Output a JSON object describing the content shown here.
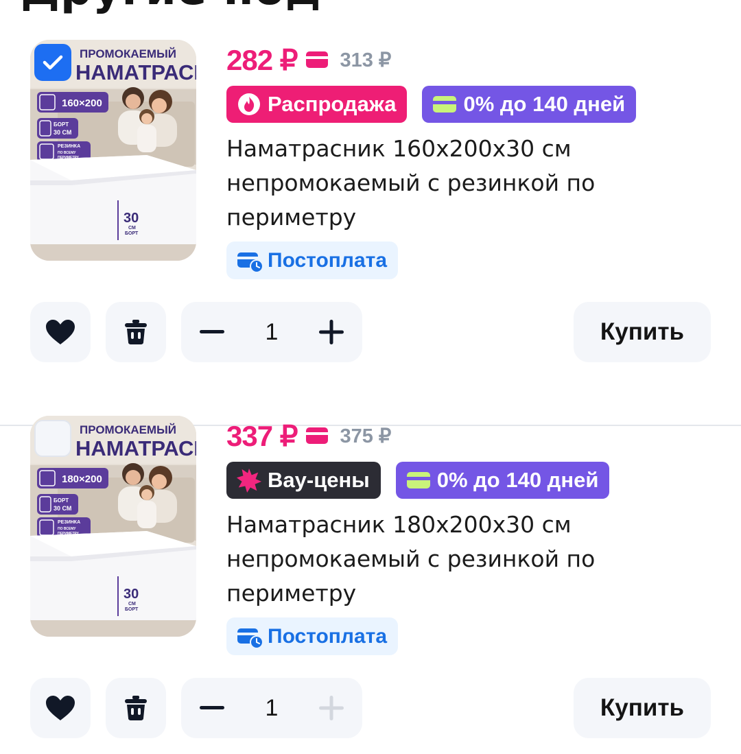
{
  "header": {
    "partial_title": "Другие под"
  },
  "items": [
    {
      "checked": true,
      "price": "282 ₽",
      "old_price": "313 ₽",
      "badges": [
        {
          "label": "Распродажа",
          "icon": "flame-icon",
          "color": "#ee1e75"
        },
        {
          "label": "0% до 140 дней",
          "icon": "card-icon",
          "color": "#7456e5"
        }
      ],
      "title": "Наматрасник 160х200х30 см непромокаемый с резинкой по периметру",
      "postpay": "Постоплата",
      "quantity": "1",
      "buy_label": "Купить",
      "plus_enabled": true,
      "image": {
        "line1": "ПРОМОКАЕМЫЙ",
        "line2": "НАМАТРАСНИК",
        "size": "160×200",
        "side_label": "БОРТ",
        "side_value": "30 СМ",
        "elastic_label": "РЕЗИНКА",
        "elastic_sub1": "ПО ВСЕМУ",
        "elastic_sub2": "ПЕРИМЕТРУ",
        "mark_value": "30",
        "mark_unit": "СМ",
        "mark_label": "БОРТ"
      }
    },
    {
      "checked": false,
      "price": "337 ₽",
      "old_price": "375 ₽",
      "badges": [
        {
          "label": "Вау-цены",
          "icon": "star-burst-icon",
          "color": "#2c2c34"
        },
        {
          "label": "0% до 140 дней",
          "icon": "card-icon",
          "color": "#7456e5"
        }
      ],
      "title": "Наматрасник 180х200х30 см непромокаемый с резинкой по периметру",
      "postpay": "Постоплата",
      "quantity": "1",
      "buy_label": "Купить",
      "plus_enabled": false,
      "image": {
        "line1": "ПРОМОКАЕМЫЙ",
        "line2": "НАМАТРАСНИК",
        "size": "180×200",
        "side_label": "БОРТ",
        "side_value": "30 СМ",
        "elastic_label": "РЕЗИНКА",
        "elastic_sub1": "ПО ВСЕМУ",
        "elastic_sub2": "ПЕРИМЕТРУ",
        "mark_value": "30",
        "mark_unit": "СМ",
        "mark_label": "БОРТ"
      }
    }
  ],
  "colors": {
    "price": "#ed1d78",
    "old_price": "#8c96a4",
    "accent_blue": "#1d6ef2",
    "postpay_text": "#1970e4",
    "postpay_bg": "#eaf4ff",
    "button_bg": "#f4f6fa"
  }
}
